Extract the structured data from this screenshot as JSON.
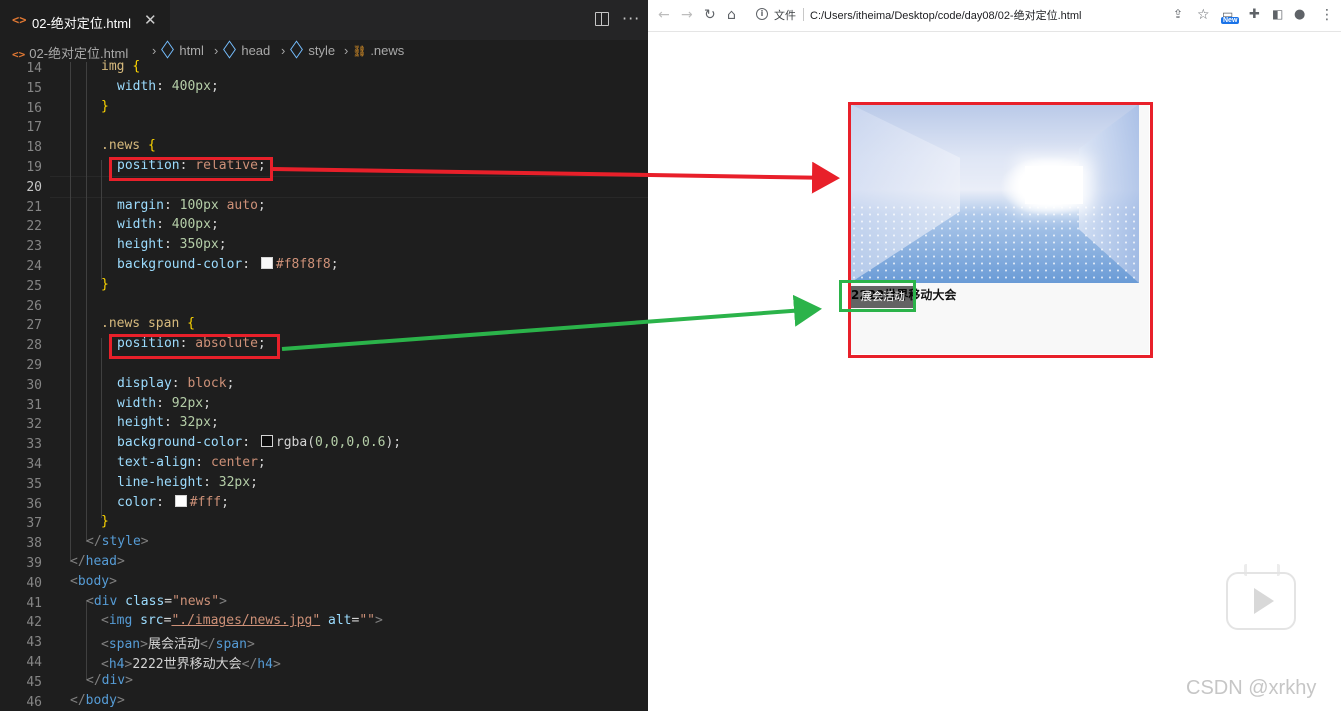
{
  "editor": {
    "tab": {
      "icon": "<>",
      "title": "02-绝对定位.html",
      "close": "✕"
    },
    "actions": {
      "more": "···"
    },
    "breadcrumb": {
      "file": "02-绝对定位.html",
      "items": [
        "html",
        "head",
        "style",
        ".news"
      ]
    },
    "line_numbers": [
      "14",
      "15",
      "16",
      "17",
      "18",
      "19",
      "20",
      "21",
      "22",
      "23",
      "24",
      "25",
      "26",
      "27",
      "28",
      "29",
      "30",
      "31",
      "32",
      "33",
      "34",
      "35",
      "36",
      "37",
      "38",
      "39",
      "40",
      "41",
      "42",
      "43",
      "44",
      "45",
      "46"
    ],
    "active_line": "20",
    "code": {
      "l14_sel": "img",
      "l14_brace": "{",
      "l15_prop": "width",
      "l15_num": "400px",
      "l16_brace": "}",
      "l18_sel": ".news",
      "l18_brace": "{",
      "l19_prop": "position",
      "l19_val": "relative",
      "l21_prop": "margin",
      "l21_num1": "100px",
      "l21_val": "auto",
      "l22_prop": "width",
      "l22_num": "400px",
      "l23_prop": "height",
      "l23_num": "350px",
      "l24_prop": "background-color",
      "l24_val": "#f8f8f8",
      "l25_brace": "}",
      "l27_sel": ".news span",
      "l27_brace": "{",
      "l28_prop": "position",
      "l28_val": "absolute",
      "l30_prop": "display",
      "l30_val": "block",
      "l31_prop": "width",
      "l31_num": "92px",
      "l32_prop": "height",
      "l32_num": "32px",
      "l33_prop": "background-color",
      "l33_fn": "rgba",
      "l33_args": "0,0,0,0.6",
      "l34_prop": "text-align",
      "l34_val": "center",
      "l35_prop": "line-height",
      "l35_num": "32px",
      "l36_prop": "color",
      "l36_val": "#fff",
      "l37_brace": "}",
      "l38_tag": "style",
      "l39_tag": "head",
      "l40_tag": "body",
      "l41_tag": "div",
      "l41_attr": "class",
      "l41_str": "\"news\"",
      "l42_tag": "img",
      "l42_attr1": "src",
      "l42_str1": "\"./images/news.jpg\"",
      "l42_attr2": "alt",
      "l42_str2": "\"\"",
      "l43_tag": "span",
      "l43_text": "展会活动",
      "l44_tag": "h4",
      "l44_text": "2222世界移动大会",
      "l45_tag": "div",
      "l46_tag": "body"
    }
  },
  "browser": {
    "protocol_label": "文件",
    "url": "C:/Users/itheima/Desktop/code/day08/02-绝对定位.html",
    "new_badge": "New",
    "page": {
      "span_text": "展会活动",
      "h4_text": "2222世界移动大会",
      "background_color": "#f8f8f8"
    }
  },
  "annotations": {
    "red": "#e8202a",
    "green": "#2bb34a"
  },
  "watermark": "CSDN @xrkhy"
}
